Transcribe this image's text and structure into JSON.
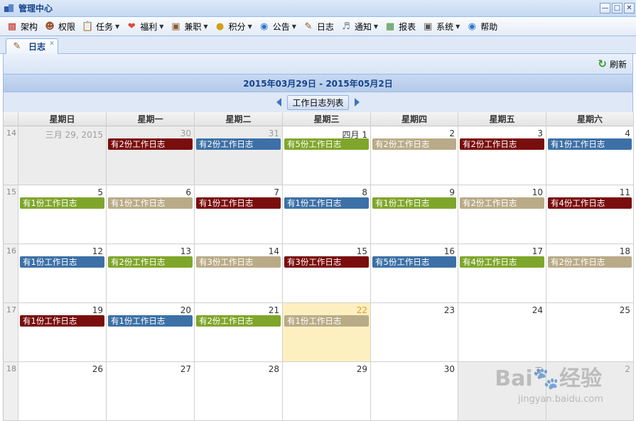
{
  "window": {
    "title": "管理中心",
    "controls": [
      "minimize",
      "maximize",
      "close"
    ]
  },
  "menu": [
    {
      "label": "架构",
      "icon": "org-chart-icon",
      "dropdown": false
    },
    {
      "label": "权限",
      "icon": "user-permission-icon",
      "dropdown": false
    },
    {
      "label": "任务",
      "icon": "task-clipboard-icon",
      "dropdown": true
    },
    {
      "label": "福利",
      "icon": "heart-icon",
      "dropdown": true
    },
    {
      "label": "兼职",
      "icon": "briefcase-icon",
      "dropdown": true
    },
    {
      "label": "积分",
      "icon": "coin-icon",
      "dropdown": true
    },
    {
      "label": "公告",
      "icon": "info-bubble-icon",
      "dropdown": true
    },
    {
      "label": "日志",
      "icon": "notebook-icon",
      "dropdown": false
    },
    {
      "label": "通知",
      "icon": "speaker-icon",
      "dropdown": true
    },
    {
      "label": "报表",
      "icon": "report-chart-icon",
      "dropdown": false
    },
    {
      "label": "系统",
      "icon": "system-screen-icon",
      "dropdown": true
    },
    {
      "label": "帮助",
      "icon": "help-bubble-icon",
      "dropdown": false
    }
  ],
  "tabs": [
    {
      "label": "日志",
      "icon": "notebook-icon",
      "closable": true,
      "active": true
    }
  ],
  "toolbar": {
    "refresh_label": "刷新"
  },
  "calendar": {
    "range_title": "2015年03月29日 - 2015年05月2日",
    "view_button": "工作日志列表",
    "weekdays": [
      "星期日",
      "星期一",
      "星期二",
      "星期三",
      "星期四",
      "星期五",
      "星期六"
    ],
    "event_colors": {
      "red": "#7a0d0d",
      "blue": "#3c70a6",
      "green": "#7fa62a",
      "tan": "#b9ab87"
    },
    "weeks": [
      {
        "week_no": "14",
        "days": [
          {
            "label": "三月 29, 2015",
            "other": true,
            "event": null
          },
          {
            "label": "30",
            "other": true,
            "event": {
              "text": "有2份工作日志",
              "color": "red"
            }
          },
          {
            "label": "31",
            "other": true,
            "event": {
              "text": "有2份工作日志",
              "color": "blue"
            }
          },
          {
            "label": "四月 1",
            "event": {
              "text": "有5份工作日志",
              "color": "green"
            }
          },
          {
            "label": "2",
            "event": {
              "text": "有2份工作日志",
              "color": "tan"
            }
          },
          {
            "label": "3",
            "event": {
              "text": "有2份工作日志",
              "color": "red"
            }
          },
          {
            "label": "4",
            "event": {
              "text": "有1份工作日志",
              "color": "blue"
            }
          }
        ]
      },
      {
        "week_no": "15",
        "days": [
          {
            "label": "5",
            "event": {
              "text": "有1份工作日志",
              "color": "green"
            }
          },
          {
            "label": "6",
            "event": {
              "text": "有1份工作日志",
              "color": "tan"
            }
          },
          {
            "label": "7",
            "event": {
              "text": "有1份工作日志",
              "color": "red"
            }
          },
          {
            "label": "8",
            "event": {
              "text": "有1份工作日志",
              "color": "blue"
            }
          },
          {
            "label": "9",
            "event": {
              "text": "有1份工作日志",
              "color": "green"
            }
          },
          {
            "label": "10",
            "event": {
              "text": "有2份工作日志",
              "color": "tan"
            }
          },
          {
            "label": "11",
            "event": {
              "text": "有4份工作日志",
              "color": "red"
            }
          }
        ]
      },
      {
        "week_no": "16",
        "days": [
          {
            "label": "12",
            "event": {
              "text": "有1份工作日志",
              "color": "blue"
            }
          },
          {
            "label": "13",
            "event": {
              "text": "有2份工作日志",
              "color": "green"
            }
          },
          {
            "label": "14",
            "event": {
              "text": "有3份工作日志",
              "color": "tan"
            }
          },
          {
            "label": "15",
            "event": {
              "text": "有3份工作日志",
              "color": "red"
            }
          },
          {
            "label": "16",
            "event": {
              "text": "有5份工作日志",
              "color": "blue"
            }
          },
          {
            "label": "17",
            "event": {
              "text": "有4份工作日志",
              "color": "green"
            }
          },
          {
            "label": "18",
            "event": {
              "text": "有2份工作日志",
              "color": "tan"
            }
          }
        ]
      },
      {
        "week_no": "17",
        "days": [
          {
            "label": "19",
            "event": {
              "text": "有1份工作日志",
              "color": "red"
            }
          },
          {
            "label": "20",
            "event": {
              "text": "有1份工作日志",
              "color": "blue"
            }
          },
          {
            "label": "21",
            "event": {
              "text": "有2份工作日志",
              "color": "green"
            }
          },
          {
            "label": "22",
            "today": true,
            "event": {
              "text": "有1份工作日志",
              "color": "tan"
            }
          },
          {
            "label": "23",
            "event": null
          },
          {
            "label": "24",
            "event": null
          },
          {
            "label": "25",
            "event": null
          }
        ]
      },
      {
        "week_no": "18",
        "days": [
          {
            "label": "26",
            "event": null
          },
          {
            "label": "27",
            "event": null
          },
          {
            "label": "28",
            "event": null
          },
          {
            "label": "29",
            "event": null
          },
          {
            "label": "30",
            "event": null
          },
          {
            "label": "五",
            "other": true,
            "event": null
          },
          {
            "label": "2",
            "other": true,
            "event": null
          }
        ]
      }
    ]
  },
  "watermark": {
    "text": "Bai du 经验",
    "sub": "jingyan.baidu.com"
  }
}
